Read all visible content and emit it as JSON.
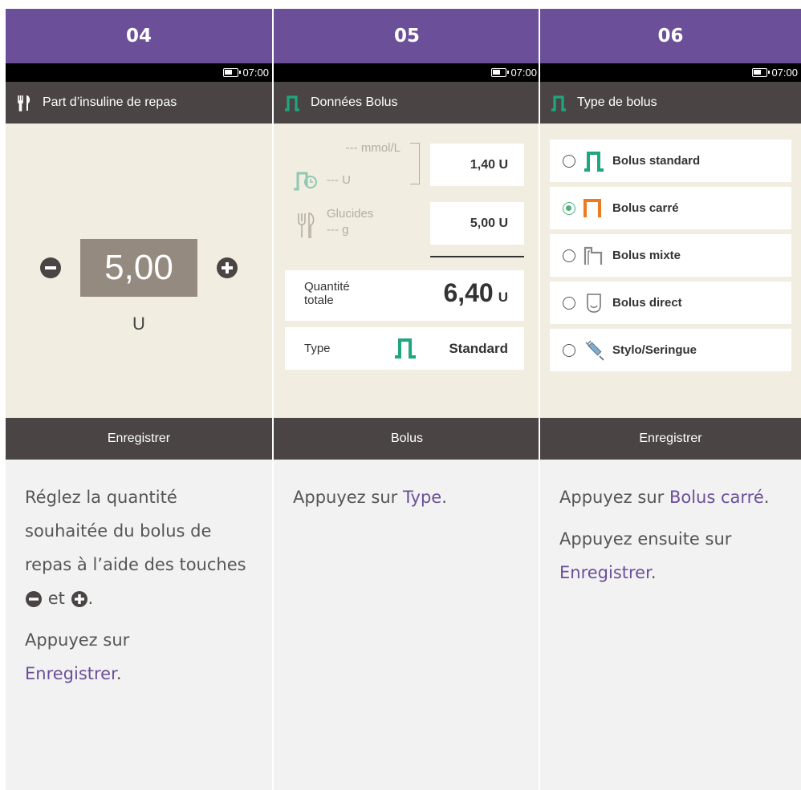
{
  "colors": {
    "accent": "#6b4f98",
    "green": "#1fa681",
    "orange": "#ee7a1f"
  },
  "panels": [
    {
      "step": "04",
      "status_time": "07:00",
      "title": "Part d’insuline de repas",
      "title_icon": "fork-knife-icon",
      "value": "5,00",
      "unit": "U",
      "footer": "Enregistrer",
      "desc": {
        "p1_text": "Réglez la quantité souhaitée du bolus de repas à l’aide des touches",
        "p1_and": "et",
        "p1_end": ".",
        "p2_pre": "Appuyez sur",
        "p2_link": "Enregistrer",
        "p2_end": "."
      }
    },
    {
      "step": "05",
      "status_time": "07:00",
      "title": "Données Bolus",
      "title_icon": "bolus-standard-icon",
      "bg_mmol": "--- mmol/L",
      "bg_u": "--- U",
      "bg_value": "1,40 U",
      "carb_label": "Glucides",
      "carb_g": "--- g",
      "carb_value": "5,00 U",
      "total_label_1": "Quantité",
      "total_label_2": "totale",
      "total_value": "6,40",
      "total_unit": "U",
      "type_label": "Type",
      "type_value": "Standard",
      "footer": "Bolus",
      "desc": {
        "pre": "Appuyez sur",
        "link": "Type",
        "end": "."
      }
    },
    {
      "step": "06",
      "status_time": "07:00",
      "title": "Type de bolus",
      "title_icon": "bolus-standard-icon",
      "options": [
        {
          "label": "Bolus standard",
          "icon": "bolus-standard-icon",
          "selected": false
        },
        {
          "label": "Bolus carré",
          "icon": "bolus-square-icon",
          "selected": true
        },
        {
          "label": "Bolus mixte",
          "icon": "bolus-mixed-icon",
          "selected": false
        },
        {
          "label": "Bolus direct",
          "icon": "bolus-direct-icon",
          "selected": false
        },
        {
          "label": "Stylo/Seringue",
          "icon": "pen-syringe-icon",
          "selected": false
        }
      ],
      "footer": "Enregistrer",
      "desc": {
        "p1_pre": "Appuyez sur",
        "p1_link": "Bolus carré",
        "p1_end": ".",
        "p2_pre": "Appuyez ensuite sur",
        "p2_link": "Enregistrer",
        "p2_end": "."
      }
    }
  ]
}
